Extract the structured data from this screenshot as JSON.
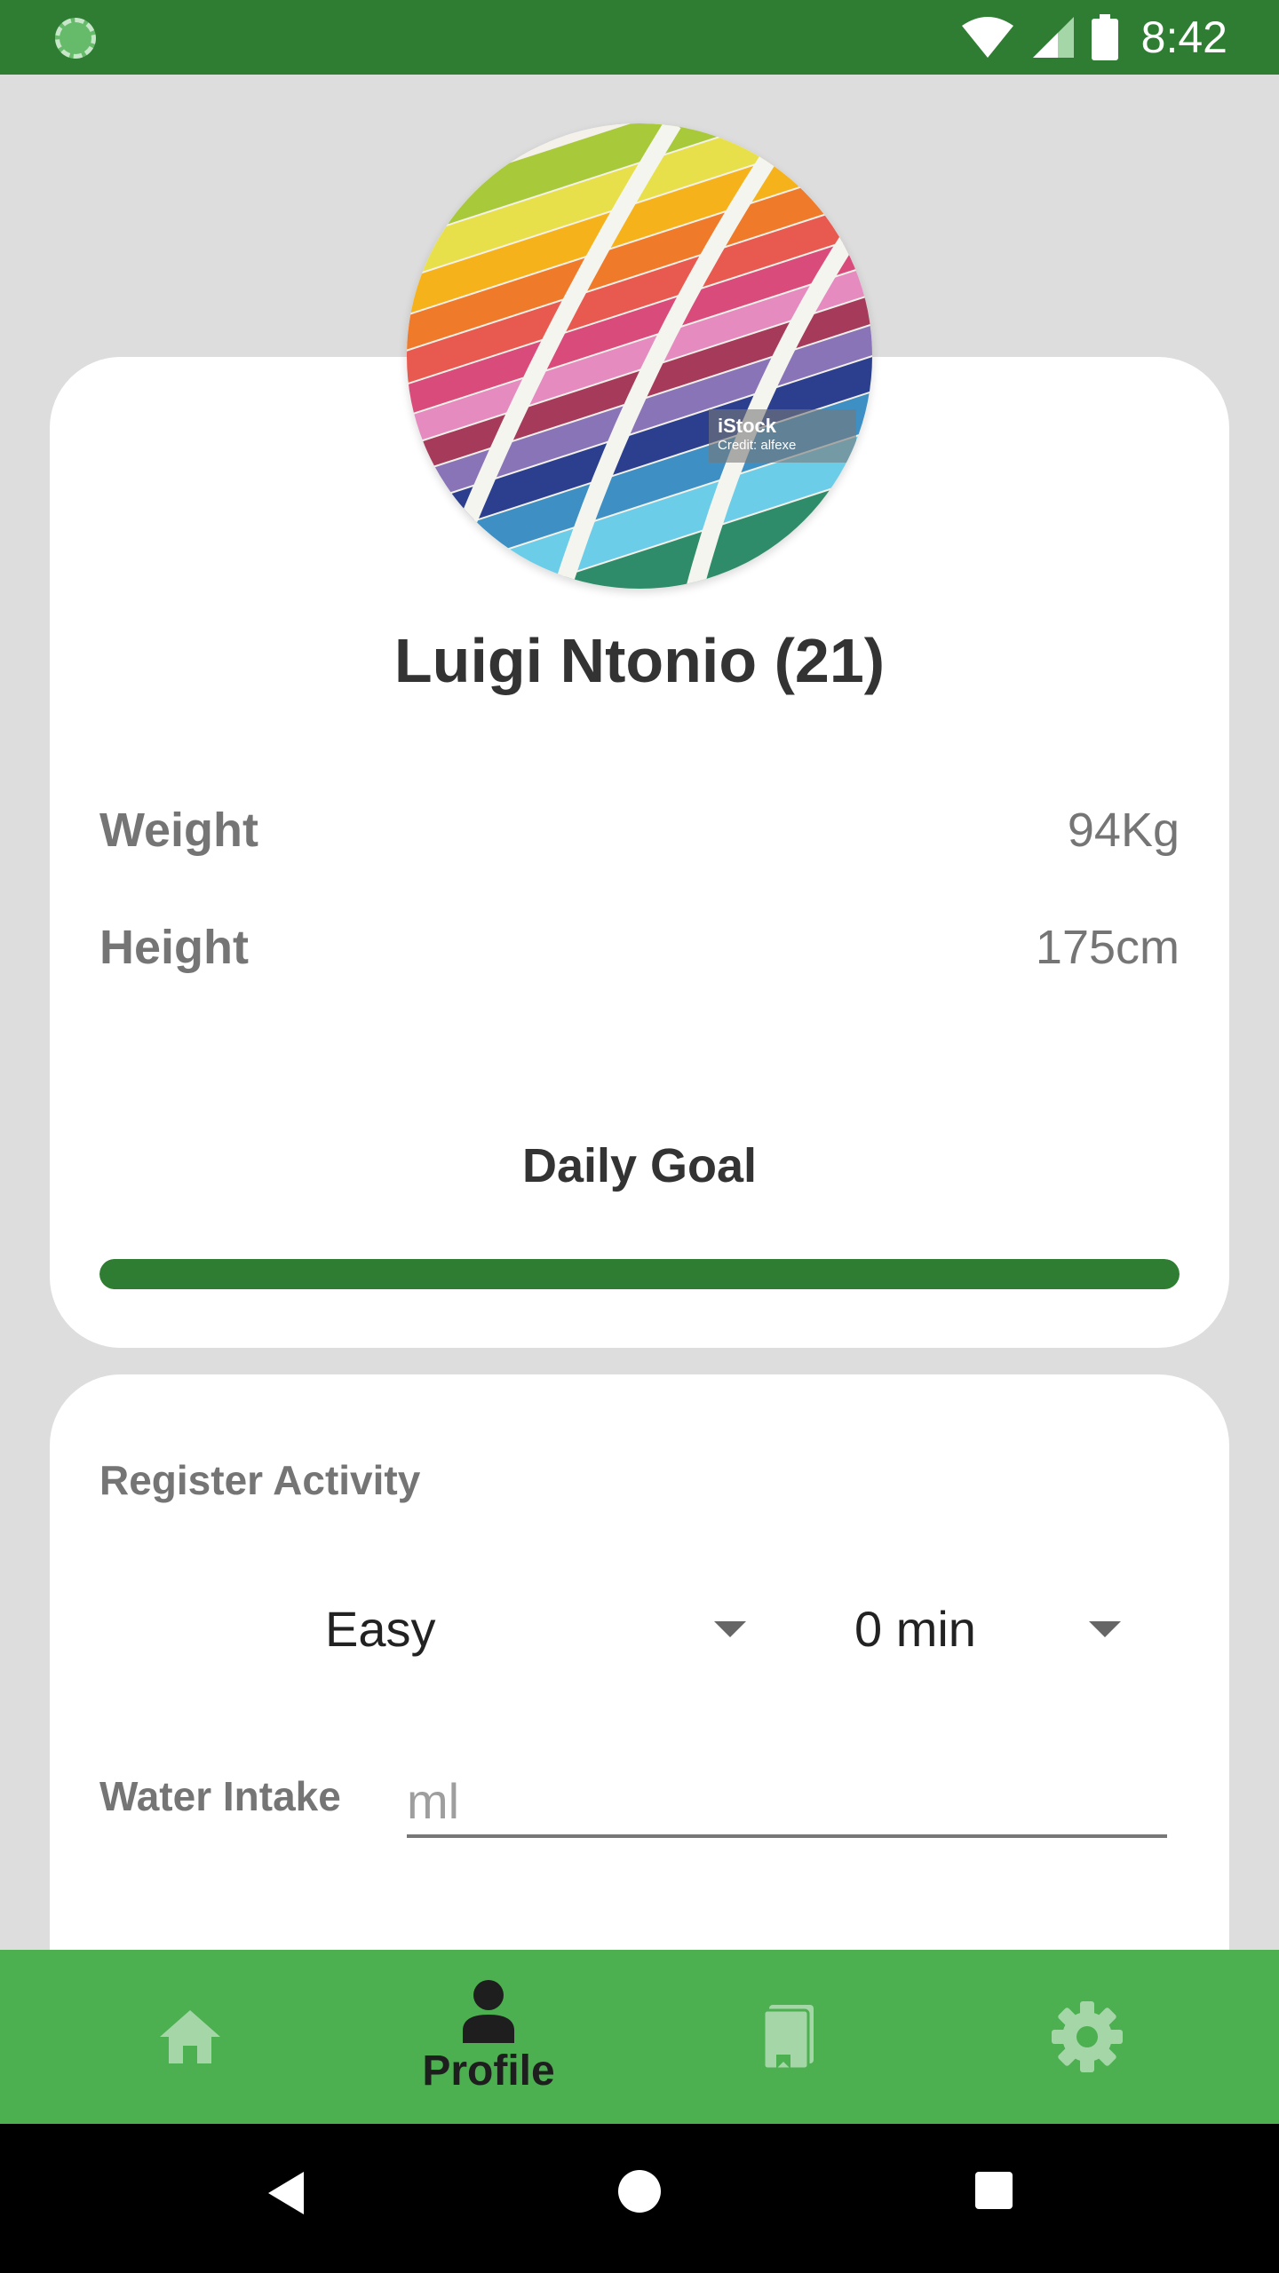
{
  "status_bar": {
    "time": "8:42"
  },
  "profile": {
    "avatar_credit_brand": "iStock",
    "avatar_credit_text": "Credit: alfexe",
    "name": "Luigi Ntonio (21)",
    "weight_label": "Weight",
    "weight_value": "94Kg",
    "height_label": "Height",
    "height_value": "175cm",
    "daily_goal_label": "Daily Goal",
    "daily_goal_progress": 1.0
  },
  "activity": {
    "title": "Register Activity",
    "intensity_value": "Easy",
    "duration_value": "0 min",
    "water_label": "Water Intake",
    "water_placeholder": "ml",
    "water_value": ""
  },
  "bottom_nav": {
    "items": [
      {
        "icon": "home-icon",
        "label": "",
        "active": false
      },
      {
        "icon": "person-icon",
        "label": "Profile",
        "active": true
      },
      {
        "icon": "book-icon",
        "label": "",
        "active": false
      },
      {
        "icon": "gear-icon",
        "label": "",
        "active": false
      }
    ]
  },
  "colors": {
    "primary_dark": "#2e7d32",
    "primary": "#4caf50",
    "inactive_icon": "#a5d6a7",
    "active_icon": "#1e1e1e"
  }
}
